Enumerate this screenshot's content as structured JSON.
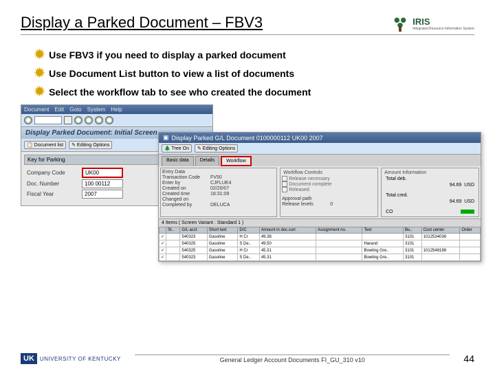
{
  "slide": {
    "title": "Display a Parked Document – FBV3",
    "bullets": [
      "Use FBV3 if you need to display a parked document",
      "Use Document List button to view a list of documents",
      "Select the workflow tab to see who created the document"
    ],
    "footer_text": "General Ledger Account Documents FI_GU_310 v10",
    "page_number": "44"
  },
  "logos": {
    "iris_name": "IRIS",
    "iris_tag": "Integrated Resource Information System",
    "uk_badge": "UK",
    "uk_name": "UNIVERSITY OF KENTUCKY"
  },
  "sap1": {
    "menu": [
      "Document",
      "Edit",
      "Goto",
      "System",
      "Help"
    ],
    "title": "Display Parked Document: Initial Screen",
    "toolbar": {
      "doclist": "Document list",
      "editopt": "Editing Options"
    },
    "group": "Key for Parking",
    "fields": {
      "company_label": "Company Code",
      "company_val": "UK00",
      "doc_label": "Doc. Number",
      "doc_val": "100 00112",
      "year_label": "Fiscal Year",
      "year_val": "2007"
    }
  },
  "sap2": {
    "title": "Display Parked G/L Document 0100000112 UK00 2007",
    "toolbar": {
      "treeon": "Tree On",
      "editopt": "Editing Options"
    },
    "tabs": [
      "Basic data",
      "Details",
      "Workflow"
    ],
    "entry_panel": {
      "rows": [
        {
          "l": "Entry Data",
          "v": ""
        },
        {
          "l": "Transaction Code",
          "v": "FV50"
        },
        {
          "l": "Enter by",
          "v": "CJFLUE4"
        },
        {
          "l": "Created on",
          "v": "02/20/07"
        },
        {
          "l": "Created time",
          "v": "18:31:09"
        },
        {
          "l": "Changed on",
          "v": ""
        },
        {
          "l": "Completed by",
          "v": "DELUCA"
        }
      ]
    },
    "workflow_panel": {
      "title": "Workflow Controls",
      "checks": [
        "Release necessary",
        "Document complete",
        "Released"
      ],
      "rows": [
        {
          "l": "Approval path",
          "v": ""
        },
        {
          "l": "Release levels",
          "v": "0"
        }
      ]
    },
    "amount_panel": {
      "title": "Amount Information",
      "rows": [
        {
          "l": "Total deb.",
          "v": "94.69",
          "u": "USD"
        },
        {
          "l": "Total cred.",
          "v": "94.69",
          "u": "USD"
        }
      ],
      "co_label": "CO"
    },
    "table": {
      "caption": "4 Items ( Screen Variant : Standard 1 )",
      "headers": [
        "St..",
        "G/L acct",
        "Short text",
        "D/C",
        "Amount in doc.curr.",
        "Assignment no.",
        "Text",
        "Bu..",
        "Cost center",
        "Order"
      ],
      "rows": [
        [
          "",
          "540323",
          "Gasoline",
          "H Cr",
          "49.38",
          "",
          "",
          "3101",
          "1012534036",
          ""
        ],
        [
          "",
          "540325",
          "Gasoline",
          "S De..",
          "49.50",
          "",
          "Harand",
          "3101",
          "",
          ""
        ],
        [
          "",
          "540325",
          "Gasoline",
          "H Cr",
          "45.31",
          "",
          "Bowling Gre..",
          "3101",
          "1012548198",
          ""
        ],
        [
          "",
          "540323",
          "Gasoline",
          "S De..",
          "45.31",
          "",
          "Bowling Gre..",
          "3101",
          "",
          ""
        ]
      ]
    }
  }
}
